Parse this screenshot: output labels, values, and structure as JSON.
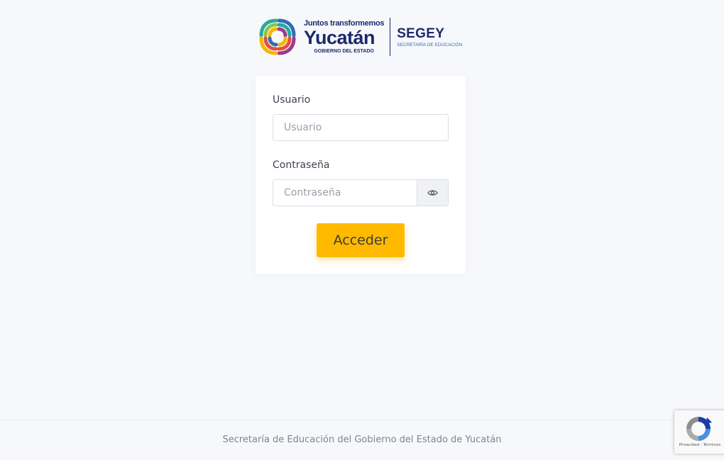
{
  "logo": {
    "tagline": "Juntos transformemos",
    "state": "Yucatán",
    "government": "GOBIERNO DEL ESTADO",
    "agency": "SEGEY",
    "agency_full": "SECRETARÍA DE EDUCACIÓN",
    "colors": [
      "#e84d3c",
      "#f7b500",
      "#27a9a0",
      "#2f6db5",
      "#9b3a8d",
      "#8cc63f"
    ]
  },
  "form": {
    "user_label": "Usuario",
    "user_placeholder": "Usuario",
    "user_value": "",
    "password_label": "Contraseña",
    "password_placeholder": "Contraseña",
    "password_value": "",
    "show_password_icon": "eye-icon",
    "submit_label": "Acceder",
    "accent_color": "#ffba00"
  },
  "footer": {
    "text": "Secretaría de Educación del Gobierno del Estado de Yucatán"
  },
  "recaptcha": {
    "icon": "recaptcha-icon",
    "privacy": "Privacidad",
    "separator": " - ",
    "terms": "Términos"
  }
}
